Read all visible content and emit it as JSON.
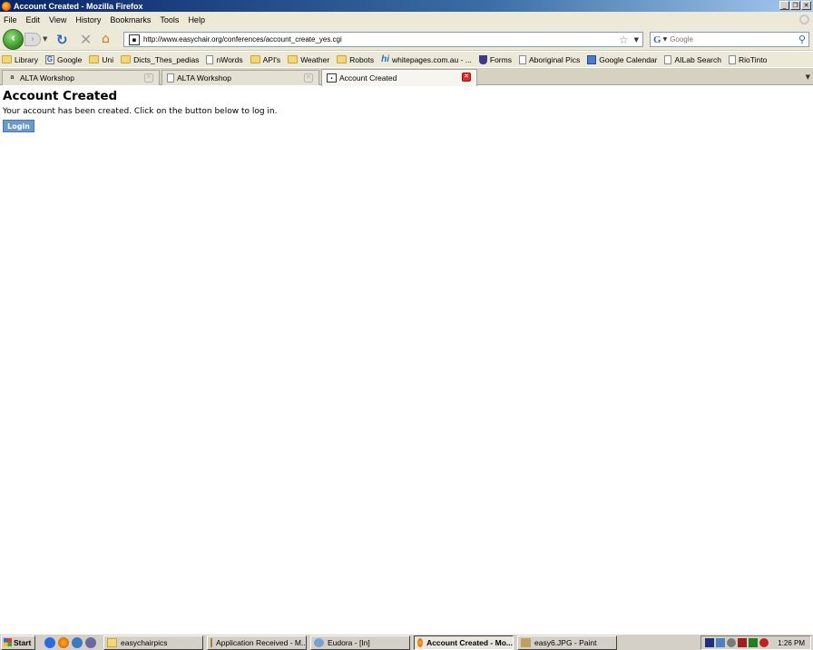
{
  "window": {
    "title": "Account Created - Mozilla Firefox",
    "min_glyph": "_",
    "max_glyph": "❐",
    "close_glyph": "✕"
  },
  "menu": [
    "File",
    "Edit",
    "View",
    "History",
    "Bookmarks",
    "Tools",
    "Help"
  ],
  "nav": {
    "back_glyph": "‹",
    "forward_glyph": "›",
    "url": "http://www.easychair.org/conferences/account_create_yes.cgi",
    "search_placeholder": "Google",
    "search_engine": "G"
  },
  "bookmarks": [
    {
      "label": "Library",
      "icon": "folder-icon"
    },
    {
      "label": "Google",
      "icon": "google-icon"
    },
    {
      "label": "Uni",
      "icon": "folder-icon"
    },
    {
      "label": "Dicts_Thes_pedias",
      "icon": "folder-icon"
    },
    {
      "label": "nWords",
      "icon": "page-icon"
    },
    {
      "label": "API's",
      "icon": "folder-icon"
    },
    {
      "label": "Weather",
      "icon": "folder-icon"
    },
    {
      "label": "Robots",
      "icon": "folder-icon"
    },
    {
      "label": "whitepages.com.au - ...",
      "icon": "hi-icon"
    },
    {
      "label": "Forms",
      "icon": "shield-icon"
    },
    {
      "label": "Aboriginal Pics",
      "icon": "page-icon"
    },
    {
      "label": "Google Calendar",
      "icon": "calendar-icon"
    },
    {
      "label": "AILab Search",
      "icon": "page-icon"
    },
    {
      "label": "RioTinto",
      "icon": "page-icon"
    }
  ],
  "tabs": [
    {
      "label": "ALTA Workshop",
      "icon": "alta-icon"
    },
    {
      "label": "ALTA Workshop",
      "icon": "page-icon"
    },
    {
      "label": "Account Created",
      "icon": "easychair-icon"
    }
  ],
  "content": {
    "heading": "Account Created",
    "message": "Your account has been created. Click on the button below to log in.",
    "login_label": "Login"
  },
  "taskbar": {
    "start_label": "Start",
    "tasks": [
      {
        "label": "easychairpics",
        "icon": "folder-icon"
      },
      {
        "label": "Application Received - M...",
        "icon": "mail-icon"
      },
      {
        "label": "Eudora - [In]",
        "icon": "eudora-icon"
      },
      {
        "label": "Account Created - Mo...",
        "icon": "firefox-icon",
        "active": true
      },
      {
        "label": "easy6.JPG - Paint",
        "icon": "paint-icon"
      }
    ],
    "clock": "1:26 PM"
  },
  "colors": {
    "login_button": "#6c9ac8",
    "titlebar": "#0a246a",
    "toolbar_bg": "#ece9d8"
  }
}
